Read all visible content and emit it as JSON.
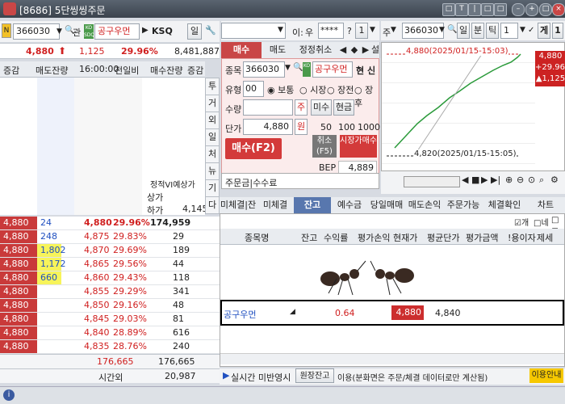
{
  "window": {
    "title": "[8686] 5단씽씽주문"
  },
  "left": {
    "code": "366030",
    "kwan": "관",
    "stock_name": "공구우먼",
    "ksq": "KSQ",
    "il": "일",
    "price": "4,880",
    "change": "1,125",
    "rate": "29.96%",
    "volume": "8,481,887",
    "headers": [
      "증감",
      "매도잔량",
      "16:00:00",
      "전일비",
      "매수잔량",
      "증감"
    ],
    "side_buttons": [
      "투",
      "거",
      "외",
      "일",
      "처",
      "뉴",
      "기",
      "다"
    ],
    "vi_labels": {
      "jungjeong": "정적VI예상가",
      "sangga": "상가",
      "haga": "하가",
      "haga_value": "4,145"
    },
    "ask_rows": [
      {
        "inc": "4,880",
        "qty": "24",
        "price": "4,880",
        "pct": "29.96%",
        "bid": "174,959"
      },
      {
        "inc": "4,880",
        "qty": "248",
        "price": "4,875",
        "pct": "29.83%",
        "bid": "29"
      },
      {
        "inc": "4,880",
        "qty": "1,802",
        "price": "4,870",
        "pct": "29.69%",
        "bid": "189"
      },
      {
        "inc": "4,880",
        "qty": "1,172",
        "price": "4,865",
        "pct": "29.56%",
        "bid": "44"
      },
      {
        "inc": "4,880",
        "qty": "660",
        "price": "4,860",
        "pct": "29.43%",
        "bid": "118"
      },
      {
        "inc": "4,880",
        "qty": "",
        "price": "4,855",
        "pct": "29.29%",
        "bid": "341"
      },
      {
        "inc": "4,880",
        "qty": "",
        "price": "4,850",
        "pct": "29.16%",
        "bid": "48"
      },
      {
        "inc": "4,880",
        "qty": "",
        "price": "4,845",
        "pct": "29.03%",
        "bid": "81"
      },
      {
        "inc": "4,880",
        "qty": "",
        "price": "4,840",
        "pct": "28.89%",
        "bid": "616"
      },
      {
        "inc": "4,880",
        "qty": "",
        "price": "4,835",
        "pct": "28.76%",
        "bid": "240"
      }
    ],
    "total_ask": "176,665",
    "total_bid": "176,665",
    "after_label": "시간외",
    "after_value": "20,987"
  },
  "order": {
    "tab_buy": "매수",
    "tab_sell": "매도",
    "tab_modify": "정정취소",
    "code_label": "종목",
    "code": "366030",
    "name": "공구우먼",
    "hyeon": "현",
    "sin": "신",
    "type_label": "유형",
    "type_code": "00",
    "radio": [
      "보통",
      "시장",
      "장전",
      "장후"
    ],
    "qty_label": "수량",
    "ju": "주",
    "misu": "미수",
    "hyeongeum": "현금",
    "price_label": "단가",
    "price": "4,880",
    "won": "원",
    "steps": [
      "50",
      "100",
      "1000"
    ],
    "buy_button": "매수(F2)",
    "cancel_button": "취소(F5)",
    "market_buy": "시장가매수",
    "bep_label": "BEP",
    "bep_value": "4,889",
    "memo": "주문금|수수료"
  },
  "top_right": {
    "i_label": "이:",
    "u_label": "우",
    "pw": "****",
    "q": "?",
    "one": "1",
    "ju": "주",
    "code": "366030",
    "il": "일",
    "bun": "분",
    "tick": "틱",
    "num": "1",
    "ge": "게",
    "il2": "1"
  },
  "chart": {
    "high_label": "4,880(2025/01/15-15:03)",
    "low_label": "4,820(2025/01/15-15:05)",
    "price_box": [
      "4,880",
      "+29.96%",
      "▲1,125"
    ]
  },
  "tabs": [
    "미체결|잔",
    "미체결",
    "잔고",
    "예수금",
    "당일매매",
    "매도손익",
    "주문가능",
    "체결확인",
    "차트"
  ],
  "options": {
    "gae": "개",
    "ne": "네",
    "jo": "조"
  },
  "holdings": {
    "headers": [
      "종목명",
      "잔고",
      "수익률",
      "평가손익",
      "현재가",
      "평균단가",
      "평가금액",
      "!용이자",
      "제세"
    ],
    "row": {
      "name": "공구우먼",
      "rate": "0.64",
      "price": "4,880",
      "avg": "4,840"
    }
  },
  "bottom": {
    "realtime": "실시간 미반영시",
    "btn": "원장잔고",
    "desc": "이용(분화면은 주문/체결 데이터로만 계산됨)",
    "guide": "이용안내"
  },
  "status": {
    "icon": "i"
  }
}
